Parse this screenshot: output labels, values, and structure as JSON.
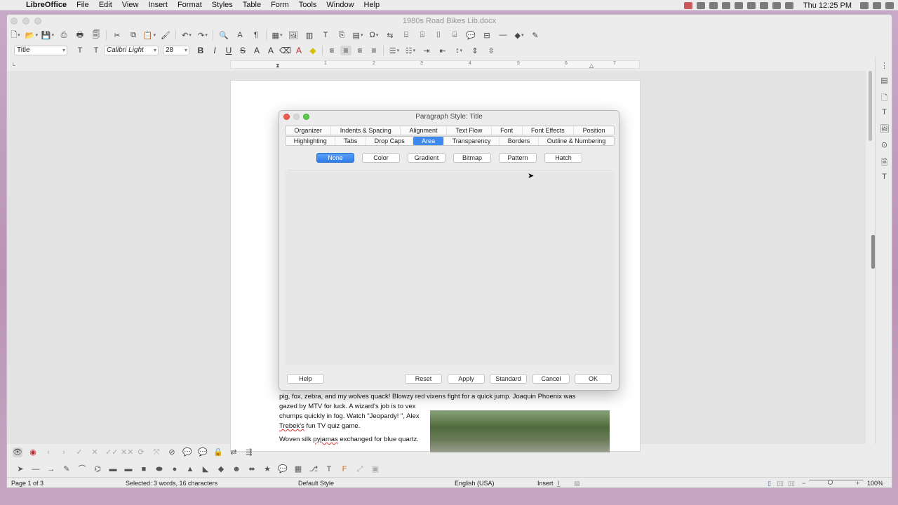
{
  "menubar": {
    "app": "LibreOffice",
    "items": [
      "File",
      "Edit",
      "View",
      "Insert",
      "Format",
      "Styles",
      "Table",
      "Form",
      "Tools",
      "Window",
      "Help"
    ],
    "clock": "Thu 12:25 PM"
  },
  "window": {
    "title": "1980s Road Bikes Lib.docx"
  },
  "formatting": {
    "paragraph_style": "Title",
    "font_name": "Calibri Light",
    "font_size": "28"
  },
  "ruler": {
    "numbers": [
      "1",
      "2",
      "3",
      "4",
      "5",
      "6",
      "7"
    ]
  },
  "document": {
    "para1_line1": "pig, fox, zebra, and my wolves quack! Blowzy red vixens fight for a quick jump. Joaquin Phoenix was",
    "para1_line2": "gazed by MTV for luck. A wizard's job is to vex",
    "para1_line3": "chumps quickly in fog. Watch \"Jeopardy! \", Alex",
    "para1_line4a": "Trebek's",
    "para1_line4b": " fun TV quiz game.",
    "para2a": "Woven silk ",
    "para2b": "pyjamas",
    "para2c": " exchanged for blue quartz."
  },
  "dialog": {
    "title": "Paragraph Style: Title",
    "tabs_row1": [
      "Organizer",
      "Indents & Spacing",
      "Alignment",
      "Text Flow",
      "Font",
      "Font Effects",
      "Position"
    ],
    "tabs_row2": [
      "Highlighting",
      "Tabs",
      "Drop Caps",
      "Area",
      "Transparency",
      "Borders",
      "Outline & Numbering"
    ],
    "active_tab": "Area",
    "area_buttons": [
      "None",
      "Color",
      "Gradient",
      "Bitmap",
      "Pattern",
      "Hatch"
    ],
    "active_area_button": "None",
    "footer": {
      "help": "Help",
      "reset": "Reset",
      "apply": "Apply",
      "standard": "Standard",
      "cancel": "Cancel",
      "ok": "OK"
    }
  },
  "statusbar": {
    "page": "Page 1 of 3",
    "selection": "Selected: 3 words, 16 characters",
    "page_style": "Default Style",
    "language": "English (USA)",
    "mode": "Insert",
    "zoom": "100%"
  },
  "colors": {
    "accent": "#3d89f0",
    "active_button": "#2f7de8"
  }
}
